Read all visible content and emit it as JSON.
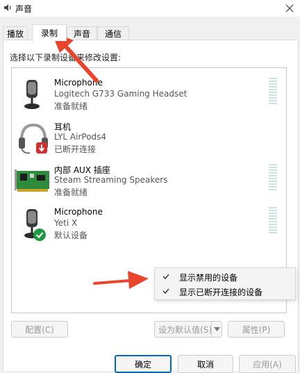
{
  "window": {
    "title": "声音",
    "close_label": "×"
  },
  "tabs": [
    {
      "label": "播放",
      "active": false
    },
    {
      "label": "录制",
      "active": true
    },
    {
      "label": "声音",
      "active": false
    },
    {
      "label": "通信",
      "active": false
    }
  ],
  "instruction": "选择以下录制设备来修改设置:",
  "devices": [
    {
      "name": "Microphone",
      "description": "Logitech G733 Gaming Headset",
      "status": "准备就绪",
      "icon": "microphone-icon"
    },
    {
      "name": "耳机",
      "description": "LYL AirPods4",
      "status": "已断开连接",
      "icon": "headset-icon",
      "badge": "disconnected-badge-icon"
    },
    {
      "name": "内部 AUX 插座",
      "description": "Steam Streaming Speakers",
      "status": "准备就绪",
      "icon": "sound-card-icon"
    },
    {
      "name": "Microphone",
      "description": "Yeti X",
      "status": "默认设备",
      "icon": "microphone-icon",
      "badge": "default-check-badge-icon"
    }
  ],
  "context_menu": {
    "items": [
      {
        "label": "显示禁用的设备",
        "checked": true
      },
      {
        "label": "显示已断开连接的设备",
        "checked": true
      }
    ]
  },
  "buttons": {
    "configure": "配置(C)",
    "set_default": "设为默认值(S)",
    "properties": "属性(P)",
    "ok": "确定",
    "cancel": "取消",
    "apply": "应用(A)"
  },
  "colors": {
    "annotation_arrow": "#e8452c",
    "accent": "#0067c0",
    "level_meter": "#c9e3e0"
  }
}
